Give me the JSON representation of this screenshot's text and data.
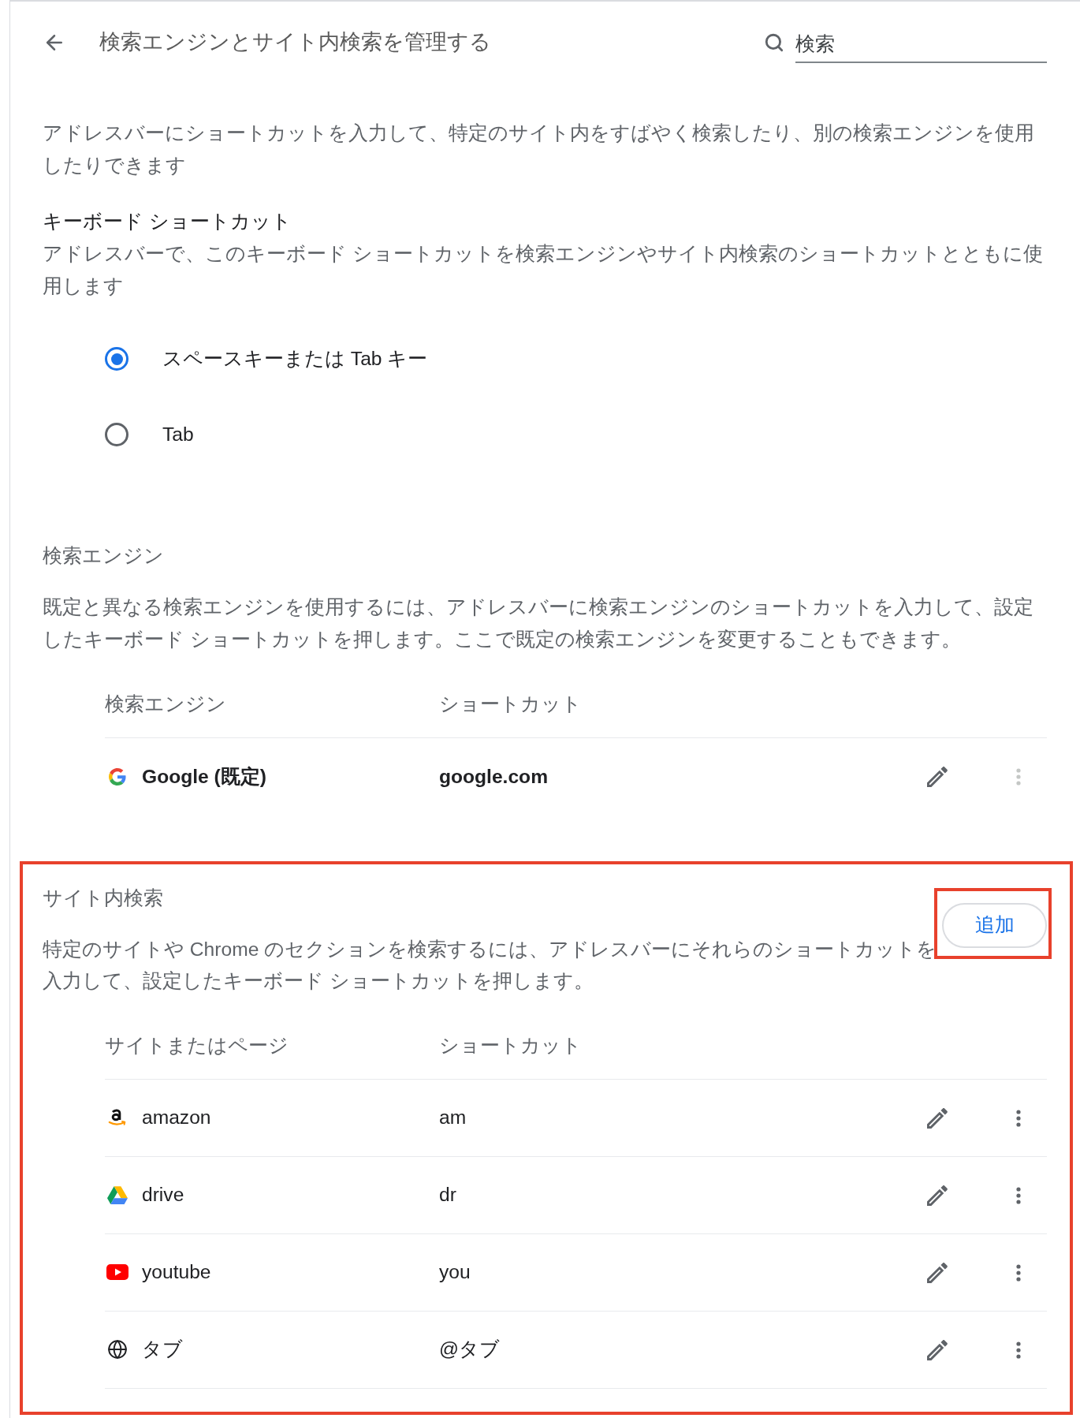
{
  "header": {
    "title": "検索エンジンとサイト内検索を管理する",
    "search": {
      "placeholder": "検索"
    }
  },
  "intro": "アドレスバーにショートカットを入力して、特定のサイト内をすばやく検索したり、別の検索エンジンを使用したりできます",
  "keyboard_shortcut": {
    "title": "キーボード ショートカット",
    "description": "アドレスバーで、このキーボード ショートカットを検索エンジンやサイト内検索のショートカットとともに使用します",
    "options": [
      {
        "label": "スペースキーまたは Tab キー",
        "selected": true
      },
      {
        "label": "Tab",
        "selected": false
      }
    ]
  },
  "search_engines": {
    "title": "検索エンジン",
    "description": "既定と異なる検索エンジンを使用するには、アドレスバーに検索エンジンのショートカットを入力して、設定したキーボード ショートカットを押します。ここで既定の検索エンジンを変更することもできます。",
    "columns": [
      "検索エンジン",
      "ショートカット"
    ],
    "rows": [
      {
        "kind": "google",
        "name": "Google (既定)",
        "shortcut": "google.com",
        "default": true
      }
    ]
  },
  "site_search": {
    "title": "サイト内検索",
    "highlighted": true,
    "description": "特定のサイトや Chrome のセクションを検索するには、アドレスバーにそれらのショートカットを入力して、設定したキーボード ショートカットを押します。",
    "add_button": {
      "label": "追加",
      "highlighted": true
    },
    "columns": [
      "サイトまたはページ",
      "ショートカット"
    ],
    "rows": [
      {
        "kind": "amazon",
        "name": "amazon",
        "shortcut": "am",
        "default": false
      },
      {
        "kind": "drive",
        "name": "drive",
        "shortcut": "dr",
        "default": false
      },
      {
        "kind": "youtube",
        "name": "youtube",
        "shortcut": "you",
        "default": false
      },
      {
        "kind": "globe",
        "name": "タブ",
        "shortcut": "@タブ",
        "default": false
      }
    ]
  }
}
